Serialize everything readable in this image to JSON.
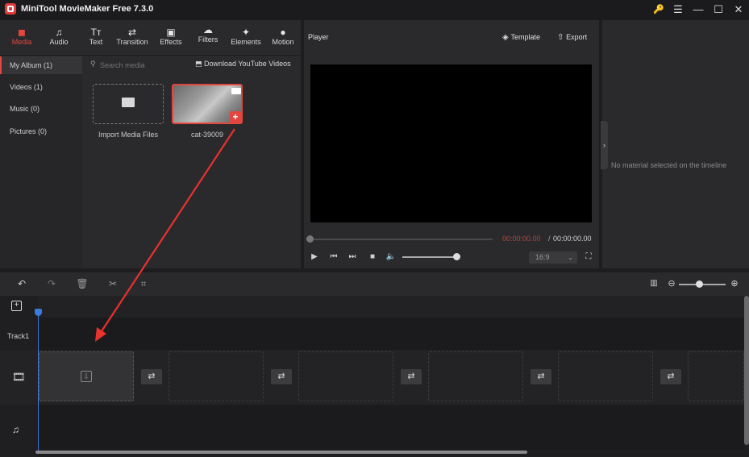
{
  "app": {
    "title": "MiniTool MovieMaker Free 7.3.0"
  },
  "window_controls": {
    "key": "🔑",
    "menu": "☰",
    "minimize": "—",
    "maximize": "☐",
    "close": "✕"
  },
  "tabs": [
    {
      "label": "Media",
      "icon": "◼"
    },
    {
      "label": "Audio",
      "icon": "♫"
    },
    {
      "label": "Text",
      "icon": "Tт"
    },
    {
      "label": "Transition",
      "icon": "⇄"
    },
    {
      "label": "Effects",
      "icon": "▣"
    },
    {
      "label": "Filters",
      "icon": "☁"
    },
    {
      "label": "Elements",
      "icon": "✦"
    },
    {
      "label": "Motion",
      "icon": "●"
    }
  ],
  "sidebar": {
    "items": [
      {
        "label": "My Album (1)"
      },
      {
        "label": "Videos (1)"
      },
      {
        "label": "Music (0)"
      },
      {
        "label": "Pictures (0)"
      }
    ]
  },
  "search": {
    "placeholder": "Search media"
  },
  "download": {
    "label": "Download YouTube Videos"
  },
  "media": {
    "import_label": "Import Media Files",
    "clip_label": "cat-39009"
  },
  "player": {
    "title": "Player",
    "template_label": "Template",
    "export_label": "Export",
    "time_current": "00:00:00.00",
    "time_separator": "/",
    "time_total": "00:00:00.00",
    "aspect": "16:9",
    "volume": 1.0
  },
  "properties": {
    "empty_text": "No material selected on the timeline"
  },
  "timeline": {
    "track1_label": "Track1",
    "zoom_level": 0.45
  }
}
